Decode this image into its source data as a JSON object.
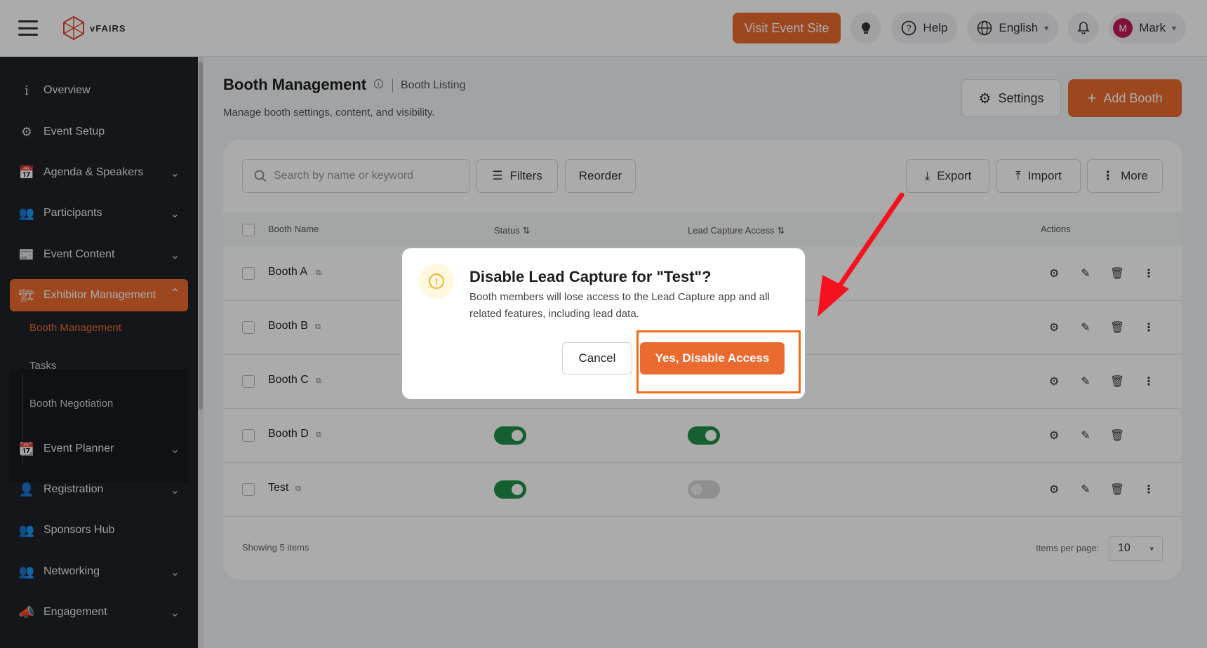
{
  "topbar": {
    "logo_text": "vFAIRS",
    "visit_label": "Visit Event Site",
    "help_label": "Help",
    "language_label": "English",
    "user_initial": "M",
    "user_name": "Mark"
  },
  "sidebar": {
    "items": [
      {
        "label": "Overview"
      },
      {
        "label": "Event Setup"
      },
      {
        "label": "Agenda & Speakers"
      },
      {
        "label": "Participants"
      },
      {
        "label": "Event Content"
      },
      {
        "label": "Exhibitor Management"
      },
      {
        "label": "Event Planner"
      },
      {
        "label": "Registration"
      },
      {
        "label": "Sponsors Hub"
      },
      {
        "label": "Networking"
      },
      {
        "label": "Engagement"
      }
    ],
    "sub_items": [
      {
        "label": "Booth Management"
      },
      {
        "label": "Tasks"
      },
      {
        "label": "Booth Negotiation"
      }
    ]
  },
  "page": {
    "title": "Booth Management",
    "breadcrumb": "Booth Listing",
    "subtitle": "Manage booth settings, content, and visibility.",
    "settings_label": "Settings",
    "add_label": "Add Booth"
  },
  "toolbar": {
    "search_placeholder": "Search by name or keyword",
    "filters_label": "Filters",
    "reorder_label": "Reorder",
    "export_label": "Export",
    "import_label": "Import",
    "more_label": "More"
  },
  "table": {
    "headers": {
      "name": "Booth Name",
      "status": "Status",
      "lead": "Lead Capture Access",
      "actions": "Actions"
    },
    "rows": [
      {
        "name": "Booth A",
        "status": null,
        "lead": null
      },
      {
        "name": "Booth B",
        "status": null,
        "lead": null
      },
      {
        "name": "Booth C",
        "status": null,
        "lead": null
      },
      {
        "name": "Booth D",
        "status": true,
        "lead": true
      },
      {
        "name": "Test",
        "status": true,
        "lead": false
      }
    ],
    "showing_text": "Showing 5 items",
    "items_per_page_label": "Items per page:",
    "items_per_page_value": "10"
  },
  "modal": {
    "title": "Disable Lead Capture for \"Test\"?",
    "body": "Booth members will lose access to the Lead Capture app and all related features, including lead data.",
    "cancel_label": "Cancel",
    "confirm_label": "Yes, Disable Access"
  },
  "colors": {
    "accent": "#ea6a2f",
    "toggle_on": "#1e8f4a",
    "highlight": "#f26a1b",
    "arrow": "#f5121e"
  }
}
